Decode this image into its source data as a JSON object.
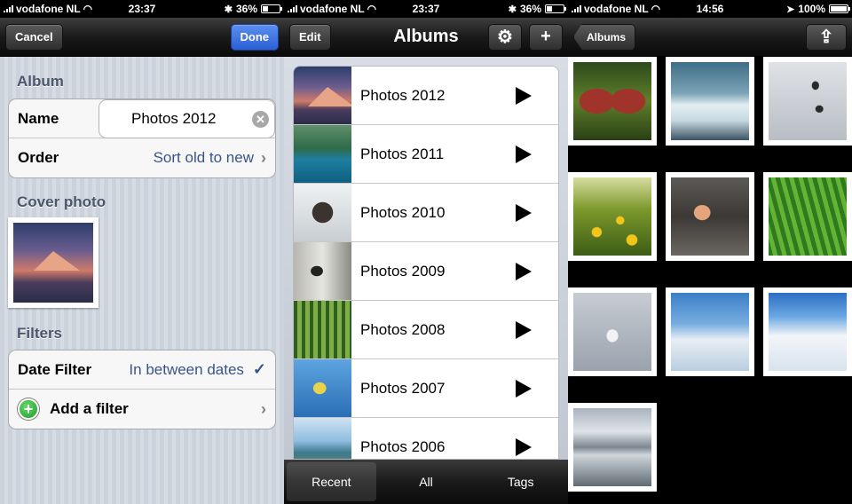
{
  "panels": [
    {
      "status": {
        "carrier": "vodafone NL",
        "time": "23:37",
        "battery": "36%"
      },
      "nav": {
        "left_button": "Cancel",
        "right_button": "Done"
      },
      "sections": {
        "album": "Album",
        "cover": "Cover photo",
        "filters": "Filters"
      },
      "album_rows": {
        "name_label": "Name",
        "name_value": "Photos 2012",
        "order_label": "Order",
        "order_value": "Sort old to new"
      },
      "filter_rows": {
        "date_filter_label": "Date Filter",
        "date_filter_value": "In between dates",
        "add_filter_label": "Add a filter"
      }
    },
    {
      "status": {
        "carrier": "vodafone NL",
        "time": "23:37",
        "battery": "36%"
      },
      "nav": {
        "left_button": "Edit",
        "title": "Albums"
      },
      "albums": [
        {
          "label": "Photos 2012",
          "thumb": "sunset-mountain"
        },
        {
          "label": "Photos 2011",
          "thumb": "blue-lake"
        },
        {
          "label": "Photos 2010",
          "thumb": "eagle"
        },
        {
          "label": "Photos 2009",
          "thumb": "woodpecker"
        },
        {
          "label": "Photos 2008",
          "thumb": "forest"
        },
        {
          "label": "Photos 2007",
          "thumb": "great-tit"
        },
        {
          "label": "Photos 2006",
          "thumb": "sea-coast"
        }
      ],
      "tabs": [
        {
          "label": "Recent",
          "selected": true
        },
        {
          "label": "All",
          "selected": false
        },
        {
          "label": "Tags",
          "selected": false
        }
      ]
    },
    {
      "status": {
        "carrier": "vodafone NL",
        "time": "14:56",
        "battery": "100%"
      },
      "nav": {
        "back_button": "Albums"
      },
      "photos": [
        "butterfly",
        "ice-peaks",
        "geese",
        "dandelions",
        "rock-in-water",
        "grass",
        "seagull",
        "snowy-trees",
        "snow-forest",
        "winter-lake"
      ]
    }
  ],
  "colors": {
    "accent_blue": "#2b5fd6",
    "value_blue": "#385487",
    "section_gray": "#4c566c",
    "add_green": "#1f9a28"
  }
}
